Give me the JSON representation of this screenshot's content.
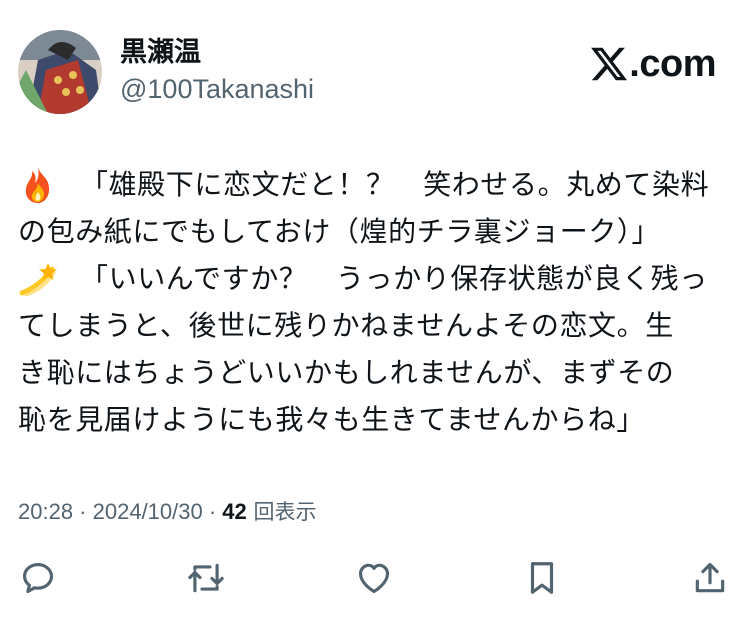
{
  "author": {
    "name": "黒瀬温",
    "handle": "@100Takanashi"
  },
  "brand": {
    "text": ".com"
  },
  "tweet": {
    "lines": [
      {
        "emoji": "fire-emoji",
        "text": "「雄殿下に恋文だと！？　笑わせる。丸めて染料"
      },
      {
        "emoji": null,
        "text": "の包み紙にでもしておけ（煌的チラ裏ジョーク）」"
      },
      {
        "emoji": "dizzy-emoji",
        "text": "「いいんですか？　うっかり保存状態が良く残っ"
      },
      {
        "emoji": null,
        "text": "てしまうと、後世に残りかねませんよその恋文。生"
      },
      {
        "emoji": null,
        "text": "き恥にはちょうどいいかもしれませんが、まずその"
      },
      {
        "emoji": null,
        "text": "恥を見届けようにも我々も生きてませんからね」"
      }
    ]
  },
  "meta": {
    "time": "20:28",
    "sep1": " · ",
    "date": "2024/10/30",
    "sep2": " · ",
    "views_count": "42",
    "views_label": " 回表示"
  },
  "actions": [
    {
      "name": "reply-icon"
    },
    {
      "name": "retweet-icon"
    },
    {
      "name": "like-icon"
    },
    {
      "name": "bookmark-icon"
    },
    {
      "name": "share-icon"
    }
  ],
  "colors": {
    "text": "#0f1419",
    "secondary": "#536471"
  }
}
